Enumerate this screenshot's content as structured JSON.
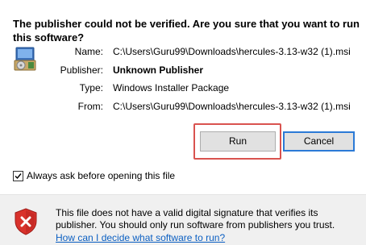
{
  "dialog": {
    "heading": "The publisher could not be verified. Are you sure that you want to run this software?"
  },
  "fields": {
    "name_label": "Name:",
    "name_value": "C:\\Users\\Guru99\\Downloads\\hercules-3.13-w32 (1).msi",
    "publisher_label": "Publisher:",
    "publisher_value": "Unknown Publisher",
    "type_label": "Type:",
    "type_value": "Windows Installer Package",
    "from_label": "From:",
    "from_value": "C:\\Users\\Guru99\\Downloads\\hercules-3.13-w32 (1).msi"
  },
  "buttons": {
    "run_label": "Run",
    "cancel_label": "Cancel"
  },
  "checkbox": {
    "label": "Always ask before opening this file",
    "checked": true
  },
  "footer": {
    "warning": "This file does not have a valid digital signature that verifies its publisher. You should only run software from publishers you trust.",
    "help_link": "How can I decide what software to run?"
  },
  "colors": {
    "highlight": "#d9534f",
    "link": "#0b5fc2",
    "focus_border": "#2b7ad6",
    "shield": "#d9322c"
  },
  "icons": {
    "installer": "windows-installer-package-icon",
    "shield": "security-shield-x-icon"
  }
}
